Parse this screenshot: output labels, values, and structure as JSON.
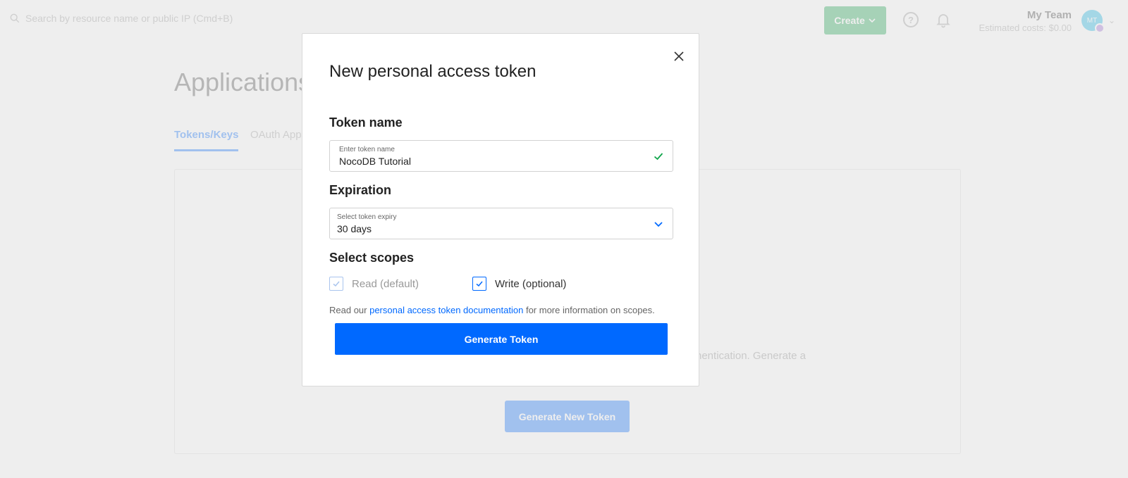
{
  "background": {
    "search": {
      "placeholder": "Search by resource name or public IP (Cmd+B)"
    },
    "header": {
      "create_label": "Create",
      "team_name": "My Team",
      "estimated_costs": "Estimated costs: $0.00",
      "avatar_initials": "MT"
    },
    "page_title": "Applications",
    "tabs": [
      {
        "label": "Tokens/Keys"
      },
      {
        "label": "OAuth App"
      }
    ],
    "panel_text": "hentication. Generate a",
    "generate_new_label": "Generate New Token"
  },
  "modal": {
    "title": "New personal access token",
    "token_name": {
      "heading": "Token name",
      "field_label": "Enter token name",
      "value": "NocoDB Tutorial"
    },
    "expiration": {
      "heading": "Expiration",
      "field_label": "Select token expiry",
      "value": "30 days"
    },
    "scopes": {
      "heading": "Select scopes",
      "read_label": "Read (default)",
      "write_label": "Write (optional)"
    },
    "info": {
      "prefix": "Read our ",
      "link_text": "personal access token documentation",
      "suffix": " for more information on scopes."
    },
    "generate_label": "Generate Token"
  },
  "colors": {
    "primary": "#0069ff",
    "create_green": "#0fa54a",
    "valid_check": "#0fa54a"
  }
}
